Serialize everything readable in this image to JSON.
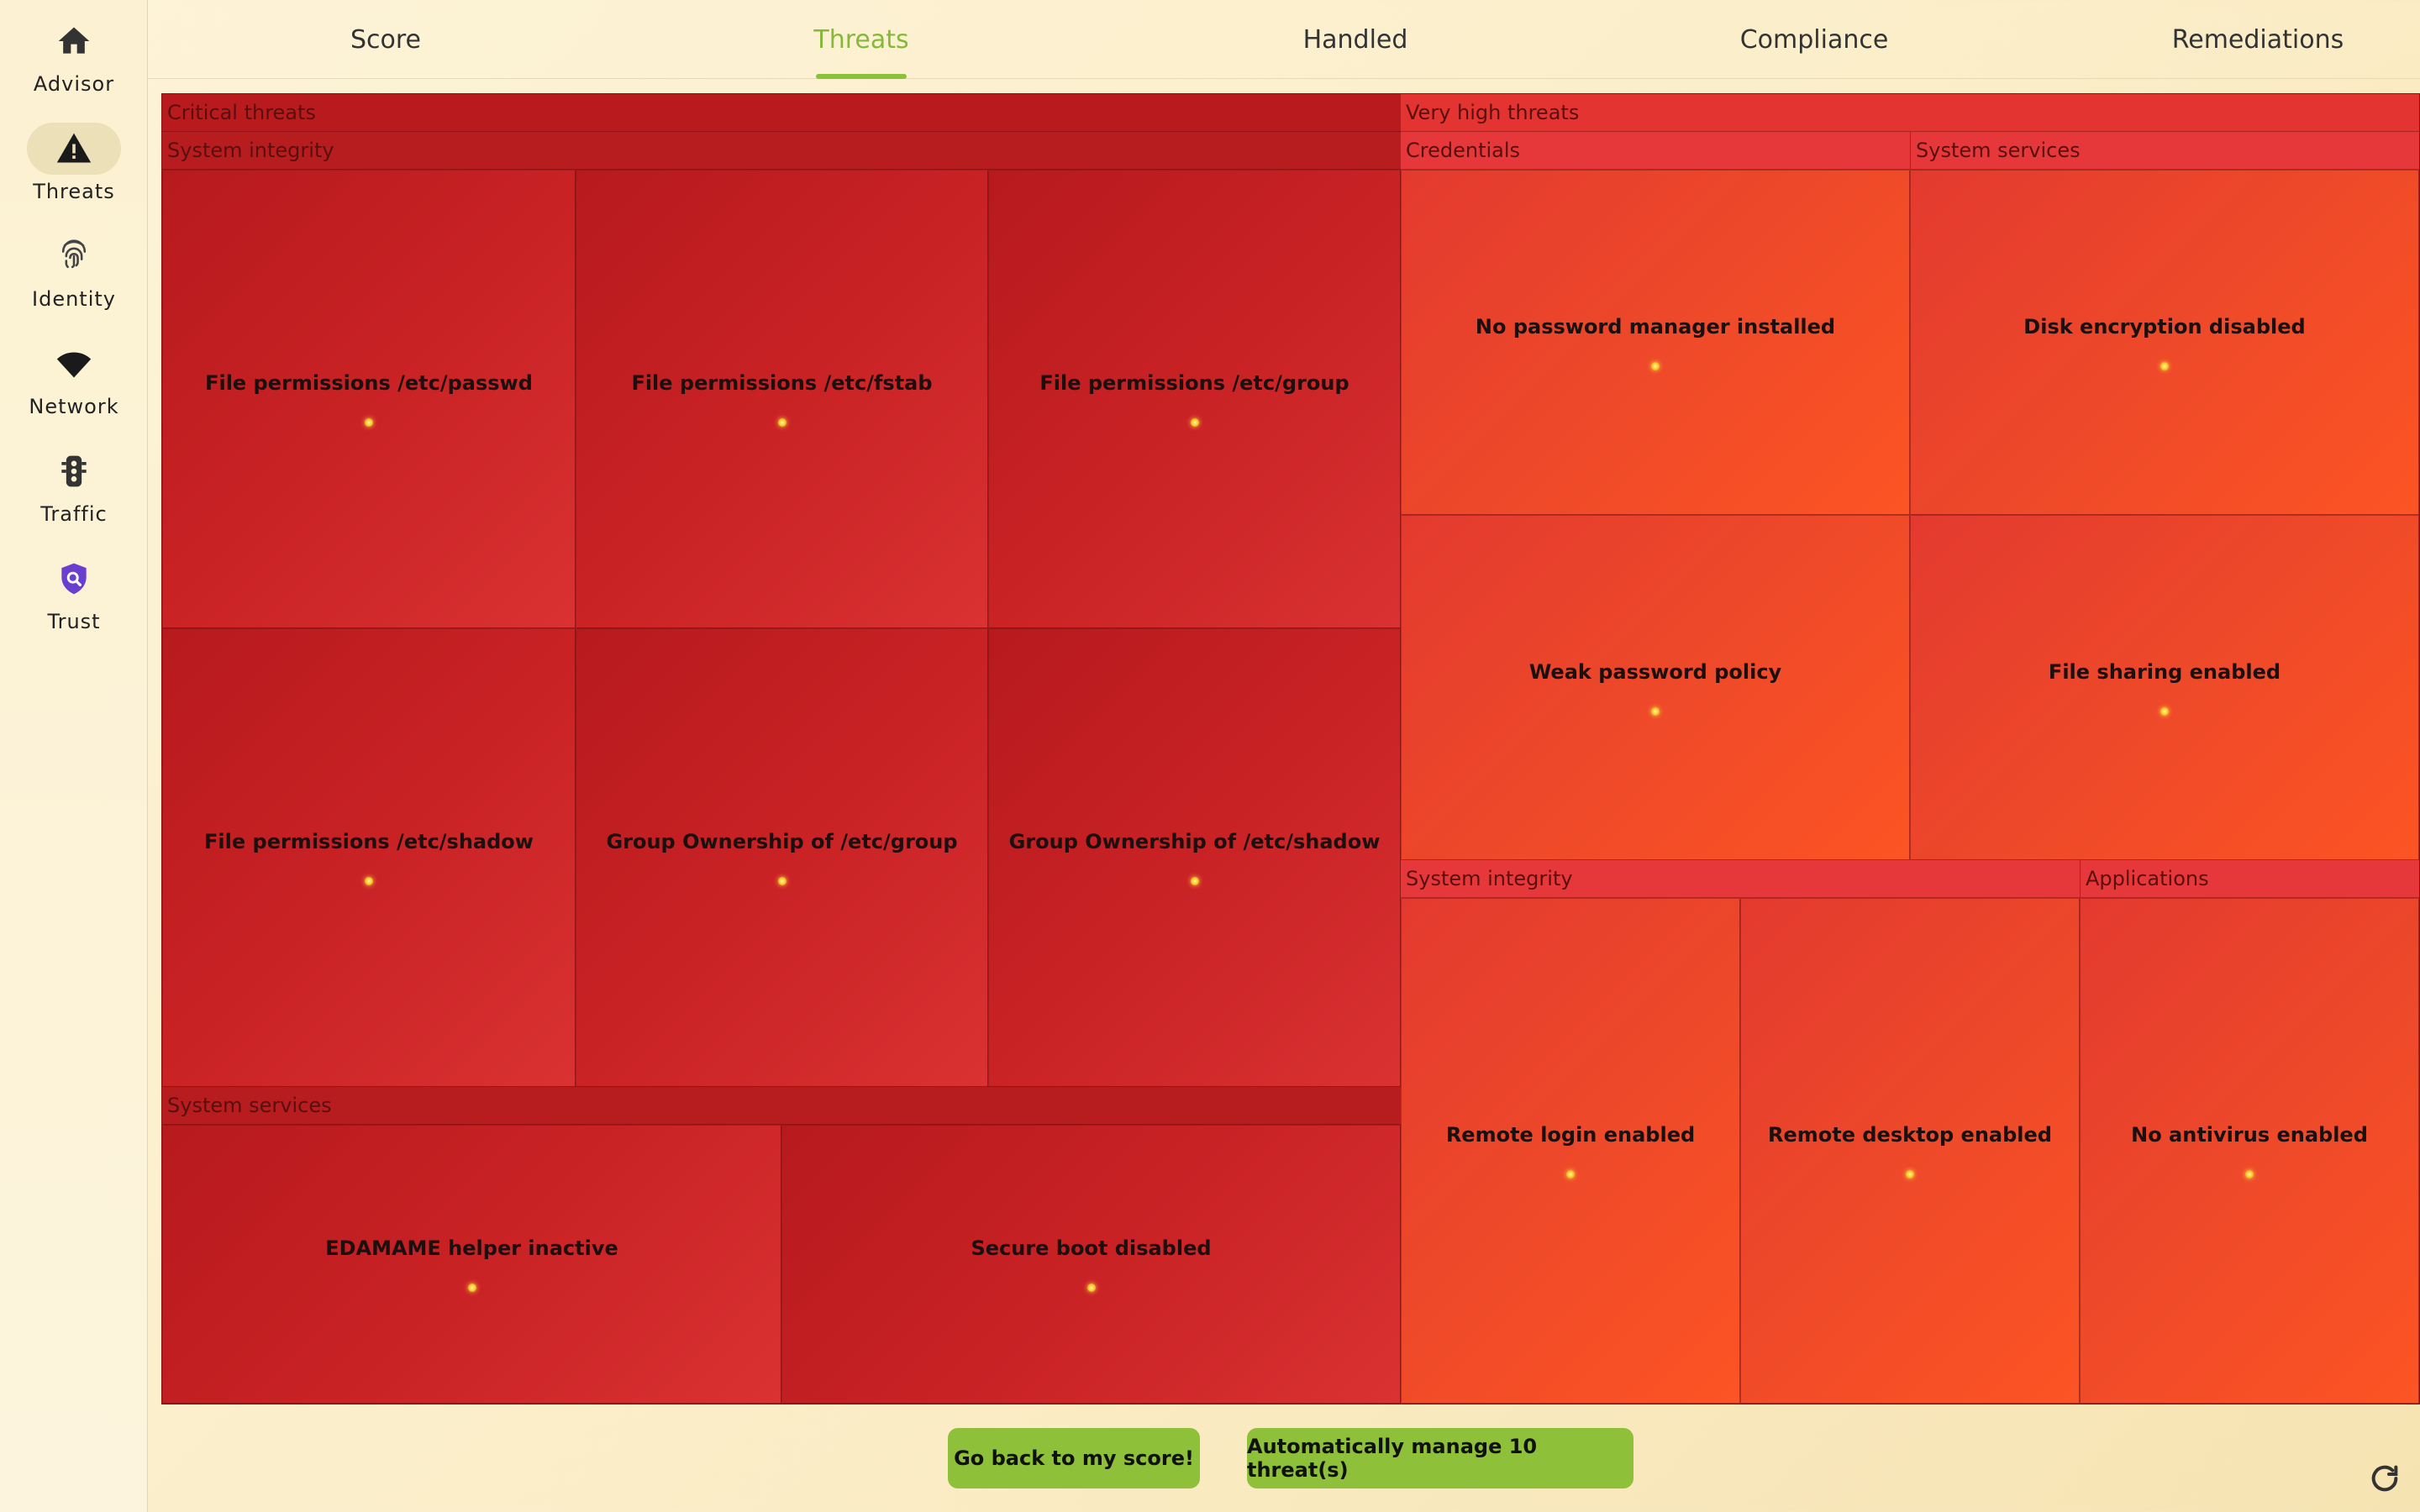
{
  "sidebar": {
    "items": [
      {
        "label": "Advisor",
        "icon": "home-icon"
      },
      {
        "label": "Threats",
        "icon": "warning-icon"
      },
      {
        "label": "Identity",
        "icon": "fingerprint-icon"
      },
      {
        "label": "Network",
        "icon": "wifi-icon"
      },
      {
        "label": "Traffic",
        "icon": "traffic-light-icon"
      },
      {
        "label": "Trust",
        "icon": "shield-search-icon"
      }
    ],
    "active": "Threats",
    "trust_icon_color": "#6a3fd0"
  },
  "tabs": {
    "items": [
      "Score",
      "Threats",
      "Handled",
      "Compliance",
      "Remediations"
    ],
    "active": "Threats",
    "accent_color": "#8cc13a"
  },
  "treemap": {
    "critical": {
      "title": "Critical threats",
      "system_integrity": {
        "title": "System integrity",
        "items": [
          "File permissions /etc/passwd",
          "File permissions /etc/fstab",
          "File permissions /etc/group",
          "File permissions /etc/shadow",
          "Group Ownership of /etc/group",
          "Group Ownership of /etc/shadow"
        ]
      },
      "system_services": {
        "title": "System services",
        "items": [
          "EDAMAME helper inactive",
          "Secure boot disabled"
        ]
      }
    },
    "very_high": {
      "title": "Very high threats",
      "credentials": {
        "title": "Credentials",
        "items": [
          "No password manager installed",
          "Weak password policy"
        ]
      },
      "system_services": {
        "title": "System services",
        "items": [
          "Disk encryption disabled",
          "File sharing enabled"
        ]
      },
      "system_integrity": {
        "title": "System integrity",
        "items": [
          "Remote login enabled",
          "Remote desktop enabled"
        ]
      },
      "applications": {
        "title": "Applications",
        "items": [
          "No antivirus enabled"
        ]
      }
    }
  },
  "buttons": {
    "back": "Go back to my score!",
    "auto_manage": "Automatically manage 10 threat(s)"
  },
  "refresh_icon": "refresh-icon"
}
